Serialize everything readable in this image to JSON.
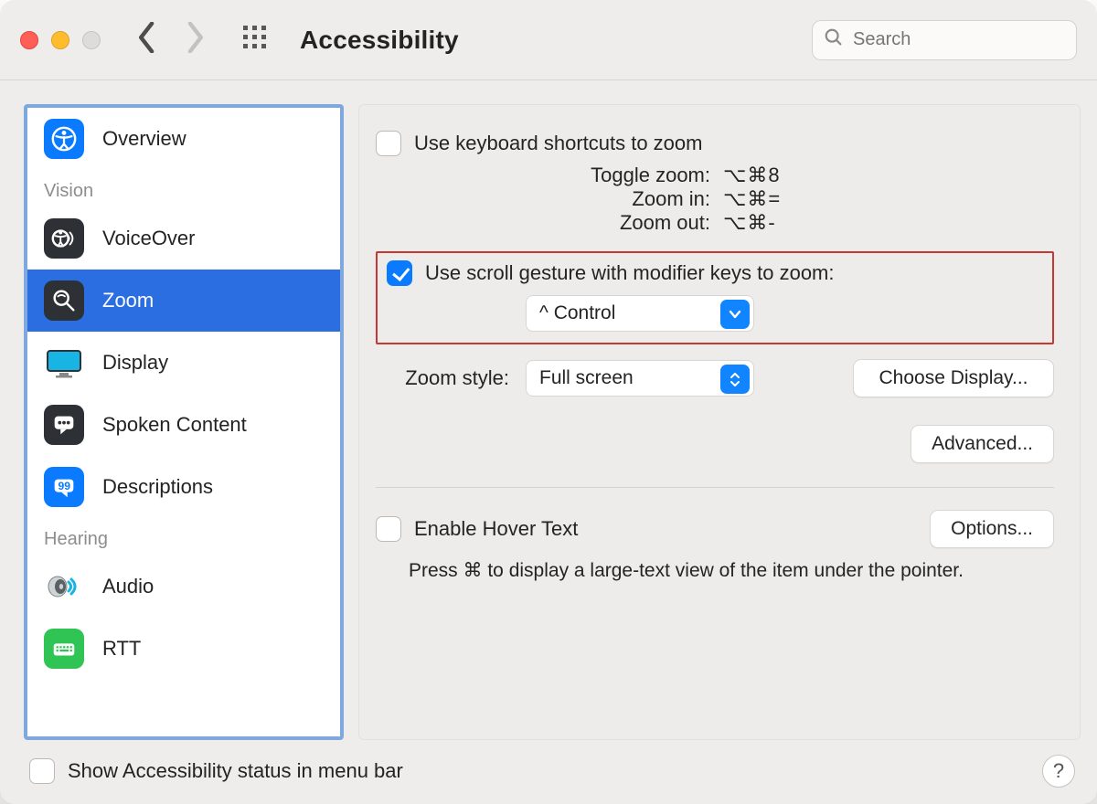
{
  "titlebar": {
    "title": "Accessibility",
    "search_placeholder": "Search"
  },
  "sidebar": {
    "overview": "Overview",
    "heading_vision": "Vision",
    "voiceover": "VoiceOver",
    "zoom": "Zoom",
    "display": "Display",
    "spoken_content": "Spoken Content",
    "descriptions": "Descriptions",
    "heading_hearing": "Hearing",
    "audio": "Audio",
    "rtt": "RTT"
  },
  "content": {
    "kbzoom_label": "Use keyboard shortcuts to zoom",
    "toggle_label": "Toggle zoom:",
    "toggle_keys": "⌥⌘8",
    "zoomin_label": "Zoom in:",
    "zoomin_keys": "⌥⌘=",
    "zoomout_label": "Zoom out:",
    "zoomout_keys": "⌥⌘-",
    "scrollgesture_label": "Use scroll gesture with modifier keys to zoom:",
    "modifier_value": "^ Control",
    "zoomstyle_label": "Zoom style:",
    "zoomstyle_value": "Full screen",
    "choose_display": "Choose Display...",
    "advanced": "Advanced...",
    "hover_label": "Enable Hover Text",
    "options": "Options...",
    "hover_desc": "Press ⌘ to display a large-text view of the item under the pointer."
  },
  "footer": {
    "statusbar_label": "Show Accessibility status in menu bar"
  }
}
